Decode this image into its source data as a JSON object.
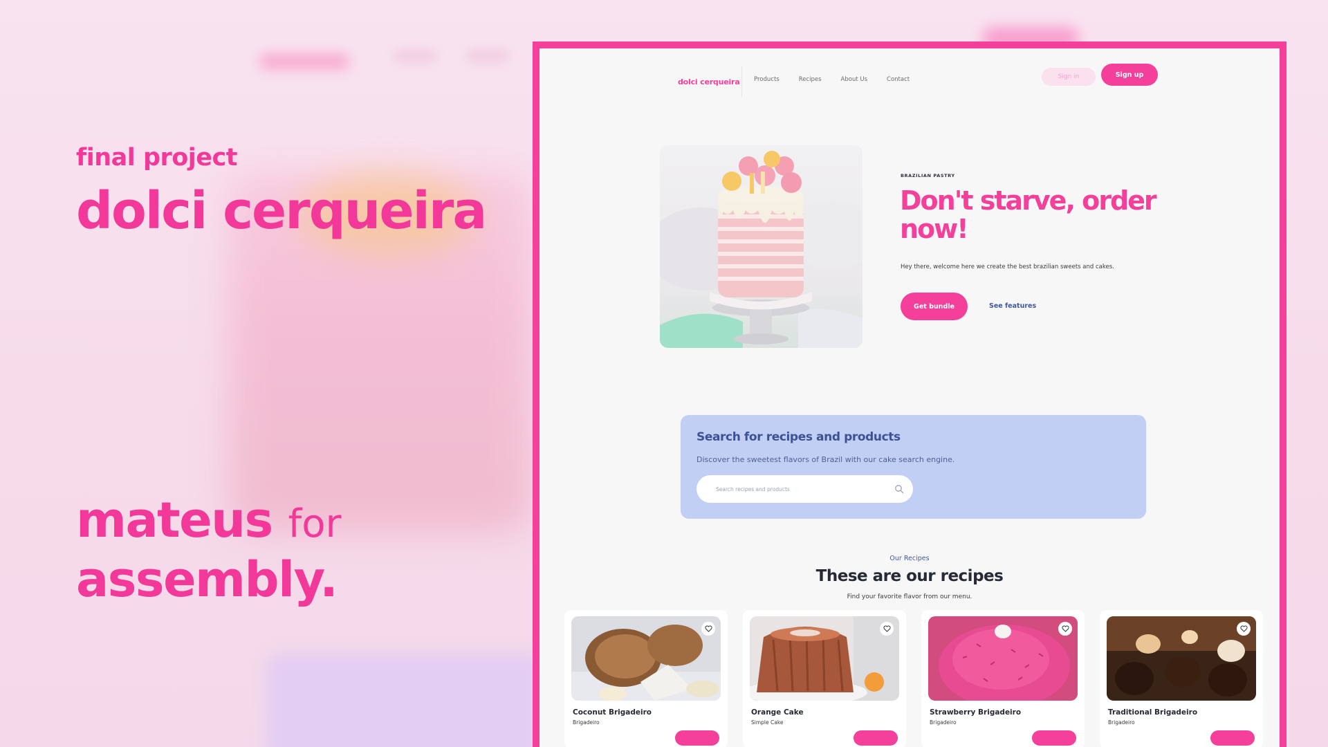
{
  "slide": {
    "subtitle": "final project",
    "title": "dolci cerqueira",
    "author_name": "mateus",
    "author_for": "for",
    "author_company": "assembly."
  },
  "site": {
    "logo": "dolci cerqueira",
    "nav": [
      "Products",
      "Recipes",
      "About Us",
      "Contact"
    ],
    "sign_in": "Sign in",
    "sign_up": "Sign up",
    "hero": {
      "tag": "BRAZILIAN PASTRY",
      "title": "Don't starve, order now!",
      "description": "Hey there, welcome here we create the best brazilian sweets and cakes.",
      "primary_button": "Get bundle",
      "secondary_link": "See features"
    },
    "search": {
      "title": "Search for recipes and products",
      "subtitle": "Discover the sweetest flavors of Brazil with our cake search engine.",
      "placeholder": "Search recipes and products"
    },
    "recipes": {
      "overline": "Our Recipes",
      "title": "These are our recipes",
      "subtitle": "Find your favorite flavor from our menu.",
      "items": [
        {
          "name": "Coconut Brigadeiro",
          "category": "Brigadeiro"
        },
        {
          "name": "Orange Cake",
          "category": "Simple Cake"
        },
        {
          "name": "Strawberry Brigadeiro",
          "category": "Brigadeiro"
        },
        {
          "name": "Traditional Brigadeiro",
          "category": "Brigadeiro"
        }
      ]
    }
  },
  "colors": {
    "brand_pink": "#f43f9b",
    "search_bg": "#c1cff5",
    "navy_text": "#41579c"
  }
}
